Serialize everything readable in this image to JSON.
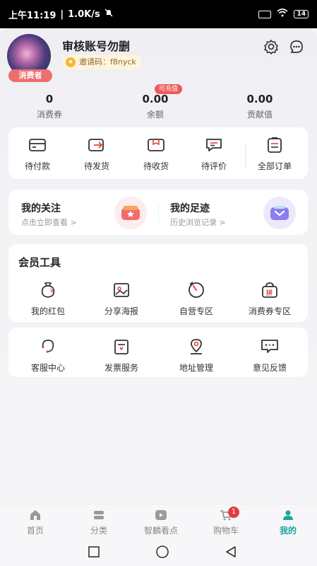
{
  "status_bar": {
    "time": "上午11:19",
    "speed": "1.0K/s",
    "battery": "14"
  },
  "profile": {
    "username": "审核账号勿删",
    "role_badge": "消费者",
    "invite_label": "邀请码：f8nyck"
  },
  "stats": [
    {
      "value": "0",
      "label": "消费券"
    },
    {
      "value": "0.00",
      "label": "余额",
      "chip": "可充值"
    },
    {
      "value": "0.00",
      "label": "贡献值"
    }
  ],
  "orders": [
    {
      "label": "待付款",
      "icon": "wallet-icon"
    },
    {
      "label": "待发货",
      "icon": "ship-icon"
    },
    {
      "label": "待收货",
      "icon": "package-icon"
    },
    {
      "label": "待评价",
      "icon": "comment-icon"
    },
    {
      "label": "全部订单",
      "icon": "list-icon"
    }
  ],
  "follow": {
    "left": {
      "title": "我的关注",
      "sub": "点击立即查看 >"
    },
    "right": {
      "title": "我的足迹",
      "sub": "历史浏览记录 >"
    }
  },
  "tools": {
    "title": "会员工具",
    "items": [
      {
        "label": "我的红包",
        "icon": "red-packet-icon"
      },
      {
        "label": "分享海报",
        "icon": "poster-icon"
      },
      {
        "label": "自营专区",
        "icon": "clock-icon"
      },
      {
        "label": "消费券专区",
        "icon": "group-buy-icon"
      }
    ]
  },
  "services": [
    {
      "label": "客服中心",
      "icon": "headset-icon"
    },
    {
      "label": "发票服务",
      "icon": "invoice-icon"
    },
    {
      "label": "地址管理",
      "icon": "location-icon"
    },
    {
      "label": "意见反馈",
      "icon": "feedback-icon"
    }
  ],
  "tabs": [
    {
      "label": "首页"
    },
    {
      "label": "分类"
    },
    {
      "label": "智麟看点"
    },
    {
      "label": "购物车",
      "badge": "1"
    },
    {
      "label": "我的",
      "active": true
    }
  ],
  "colors": {
    "accent": "#1ba59b",
    "badge_red": "#e43b3b",
    "role_badge": "#ee6e6e"
  }
}
